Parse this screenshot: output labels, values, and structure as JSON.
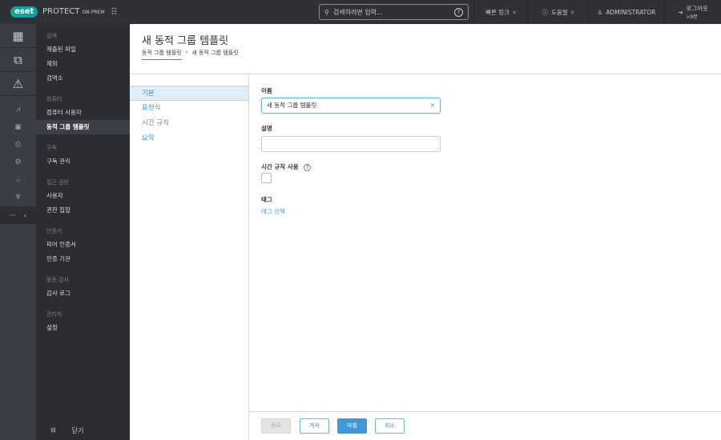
{
  "topbar": {
    "logo": "eset",
    "product": "PROTECT",
    "product_suffix": "ON-PREM",
    "search_placeholder": "검색하려면 입력...",
    "quick_links": "빠른 링크",
    "help": "도움말",
    "user": "ADMINISTRATOR",
    "logout": "로그아웃",
    "logout_time": ">9분"
  },
  "sidebar": {
    "sections": [
      {
        "header": "검색",
        "items": [
          "제출된 파일",
          "제외",
          "검역소"
        ]
      },
      {
        "header": "컴퓨터",
        "items": [
          "컴퓨터 사용자",
          "동적 그룹 템플릿"
        ]
      },
      {
        "header": "구독",
        "items": [
          "구독 관리"
        ]
      },
      {
        "header": "접근 권한",
        "items": [
          "사용자",
          "권한 집합"
        ]
      },
      {
        "header": "인증서",
        "items": [
          "피어 인증서",
          "인증 기관"
        ]
      },
      {
        "header": "활동 감사",
        "items": [
          "감사 로그"
        ]
      },
      {
        "header": "관리자",
        "items": [
          "설정"
        ]
      }
    ],
    "active": "동적 그룹 템플릿",
    "close": "닫기",
    "more": "···"
  },
  "page": {
    "title": "새 동적 그룹 템플릿",
    "breadcrumb": [
      "동적 그룹 템플릿",
      "새 동적 그룹 템플릿"
    ]
  },
  "wizard_nav": [
    "기본",
    "표현식",
    "시간 규칙",
    "요약"
  ],
  "form": {
    "name_label": "이름",
    "name_value": "새 동적 그룹 템플릿",
    "desc_label": "설명",
    "desc_value": "",
    "time_rule_label": "시간 규칙 사용",
    "time_rule_checked": false,
    "tags_label": "태그",
    "tags_link": "태그 선택"
  },
  "footer": {
    "back": "뒤로",
    "continue": "계속",
    "finish": "마침",
    "cancel": "취소"
  },
  "colors": {
    "accent": "#3d9ad8",
    "brand": "#0ba5a0"
  }
}
